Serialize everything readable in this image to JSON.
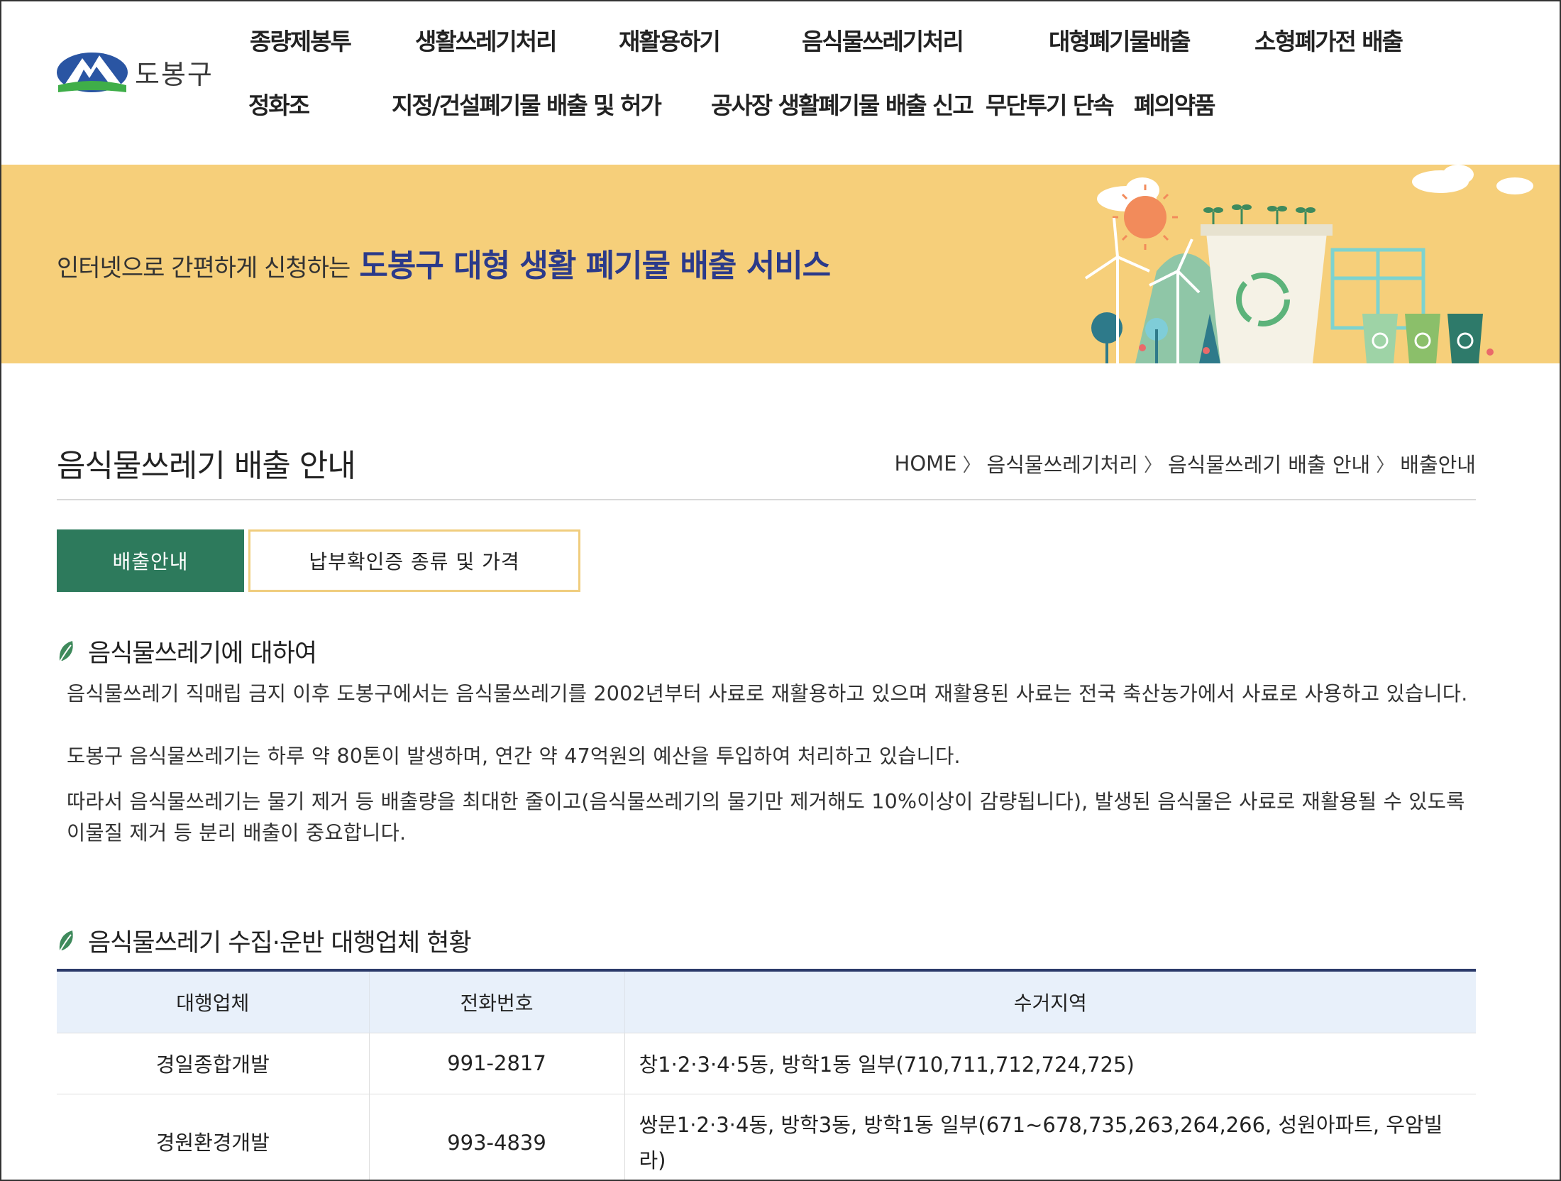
{
  "header": {
    "logo_text": "도봉구",
    "nav_row1": [
      "종량제봉투",
      "생활쓰레기처리",
      "재활용하기",
      "음식물쓰레기처리",
      "대형폐기물배출",
      "소형폐가전 배출"
    ],
    "nav_row2": [
      "정화조",
      "지정/건설폐기물 배출 및 허가",
      "공사장 생활폐기물 배출 신고",
      "무단투기 단속",
      "폐의약품"
    ]
  },
  "banner": {
    "sub": "인터넷으로 간편하게 신청하는",
    "main": "도봉구 대형 생활 폐기물 배출 서비스"
  },
  "page": {
    "title": "음식물쓰레기 배출 안내",
    "breadcrumb": [
      "HOME",
      "음식물쓰레기처리",
      "음식물쓰레기 배출 안내",
      "배출안내"
    ]
  },
  "tabs": [
    {
      "label": "배출안내",
      "active": true
    },
    {
      "label": "납부확인증 종류 및 가격",
      "active": false
    }
  ],
  "section1": {
    "heading": "음식물쓰레기에 대하여",
    "p1": "음식물쓰레기 직매립 금지 이후 도봉구에서는 음식물쓰레기를 2002년부터 사료로 재활용하고 있으며 재활용된 사료는 전국 축산농가에서 사료로 사용하고 있습니다.",
    "p2": "도봉구 음식물쓰레기는 하루 약 80톤이 발생하며, 연간 약 47억원의 예산을 투입하여 처리하고 있습니다.",
    "p3": "따라서 음식물쓰레기는 물기 제거 등 배출량을 최대한 줄이고(음식물쓰레기의 물기만 제거해도 10%이상이 감량됩니다), 발생된 음식물은 사료로 재활용될 수 있도록 이물질 제거 등 분리 배출이 중요합니다."
  },
  "section2": {
    "heading": "음식물쓰레기 수집·운반 대행업체 현황",
    "columns": [
      "대행업체",
      "전화번호",
      "수거지역"
    ],
    "rows": [
      [
        "경일종합개발",
        "991-2817",
        "창1·2·3·4·5동, 방학1동 일부(710,711,712,724,725)"
      ],
      [
        "경원환경개발",
        "993-4839",
        "쌍문1·2·3·4동, 방학3동, 방학1동 일부(671~678,735,263,264,266, 성원아파트, 우암빌라)"
      ]
    ]
  },
  "colors": {
    "tab_active": "#2d7a5c",
    "tab_border": "#f0cd7e",
    "banner_bg": "#f6cf7a",
    "banner_title": "#2b3a8a",
    "table_header_bg": "#e8f0fa"
  }
}
